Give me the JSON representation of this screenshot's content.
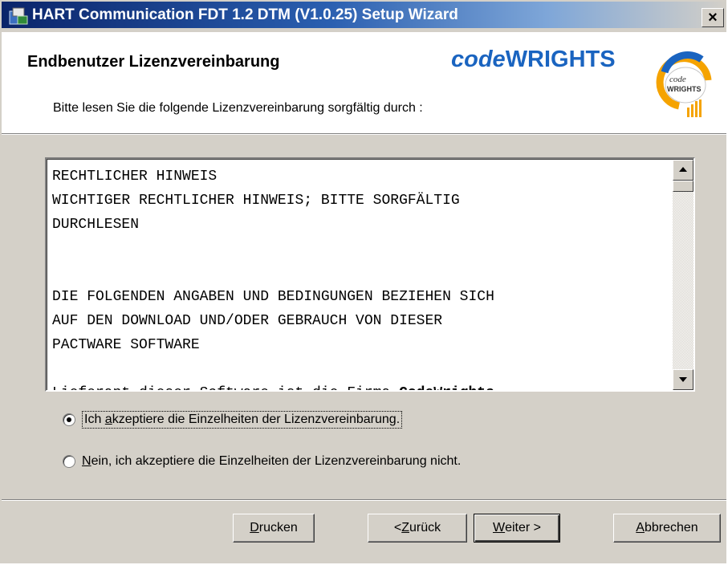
{
  "window": {
    "title": "HART Communication FDT 1.2 DTM (V1.0.25) Setup Wizard",
    "close_glyph": "×"
  },
  "header": {
    "title": "Endbenutzer Lizenzvereinbarung",
    "subtitle": "Bitte lesen Sie die folgende Lizenzvereinbarung sorgfältig durch :",
    "brand_prefix": "code",
    "brand_suffix": "WRIGHTS",
    "logo_text_top": "code",
    "logo_text_bottom": "WRIGHTS"
  },
  "license": {
    "lines": [
      "RECHTLICHER HINWEIS",
      "WICHTIGER RECHTLICHER HINWEIS; BITTE SORGFÄLTIG",
      "DURCHLESEN",
      "DIE FOLGENDEN ANGABEN UND BEDINGUNGEN BEZIEHEN SICH",
      "AUF DEN DOWNLOAD UND/ODER GEBRAUCH VON DIESER",
      "PACTWARE SOFTWARE",
      "Lieferant dieser Software ist die Firma "
    ],
    "company_bold": "CodeWrights"
  },
  "options": {
    "accept": {
      "before": "Ich ",
      "underlined": "a",
      "after": "kzeptiere die Einzelheiten der Lizenzvereinbarung.",
      "checked": true
    },
    "decline": {
      "underlined": "N",
      "after": "ein, ich akzeptiere die Einzelheiten der Lizenzvereinbarung nicht.",
      "checked": false
    }
  },
  "buttons": {
    "print": {
      "underlined": "D",
      "rest": "rucken"
    },
    "back": {
      "prefix": "< ",
      "underlined": "Z",
      "rest": "urück"
    },
    "next": {
      "underlined": "W",
      "rest": "eiter >"
    },
    "cancel": {
      "underlined": "A",
      "rest": "bbrechen"
    }
  },
  "colors": {
    "title_start": "#0a246a",
    "brand_blue": "#1a64c0",
    "dialog_bg": "#d4d0c8",
    "logo_orange": "#f5a300"
  }
}
